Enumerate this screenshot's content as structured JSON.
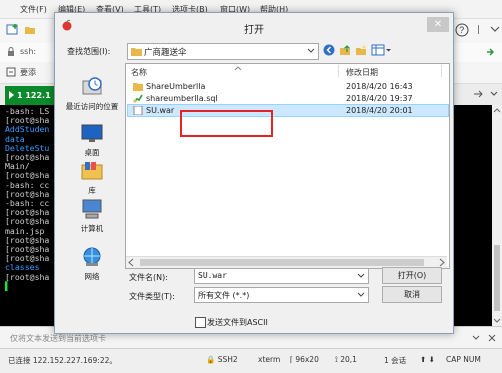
{
  "background_app": {
    "menu": [
      "文件(F)",
      "编辑(E)",
      "查看(V)",
      "工具(T)",
      "选项卡(B)",
      "窗口(W)",
      "帮助(H)"
    ],
    "address_text": "ssh:",
    "quick_label": "要添",
    "tab_label": "1 122.1",
    "terminal_lines": [
      {
        "text": "-bash: LS",
        "color": "#cfcfcf"
      },
      {
        "text": "[root@sha",
        "color": "#cfcfcf"
      },
      {
        "text": "AddStuden",
        "color": "#3a9cff"
      },
      {
        "text": "data",
        "color": "#3a9cff"
      },
      {
        "text": "DeleteStu",
        "color": "#3a9cff"
      },
      {
        "text": "[root@sha",
        "color": "#cfcfcf"
      },
      {
        "text": "Main/",
        "color": "#cfcfcf"
      },
      {
        "text": "[root@sha",
        "color": "#cfcfcf"
      },
      {
        "text": "-bash: cc",
        "color": "#cfcfcf"
      },
      {
        "text": "[root@sha",
        "color": "#cfcfcf"
      },
      {
        "text": "-bash: cc",
        "color": "#cfcfcf"
      },
      {
        "text": "[root@sha",
        "color": "#cfcfcf"
      },
      {
        "text": "[root@sha",
        "color": "#cfcfcf"
      },
      {
        "text": "main.jsp",
        "color": "#cfcfcf"
      },
      {
        "text": "[root@sha",
        "color": "#cfcfcf"
      },
      {
        "text": "[root@sha",
        "color": "#cfcfcf"
      },
      {
        "text": "[root@sha",
        "color": "#cfcfcf"
      },
      {
        "text": "classes",
        "color": "#3a9cff"
      },
      {
        "text": "[root@sha",
        "color": "#cfcfcf"
      },
      {
        "text": "▌",
        "color": "#19e04a"
      }
    ],
    "send_bar_placeholder": "仅将文本发送到当前选项卡",
    "status": {
      "connection": "已连接 122.152.227.169:22。",
      "protocol": "SSH2",
      "term": "xterm",
      "size": "96x20",
      "cursor": "20,1",
      "sessions": "1 会话",
      "keys": "CAP  NUM"
    }
  },
  "dialog": {
    "title": "打开",
    "look_in_label": "查找范围(I):",
    "look_in_value": "广商趣送伞",
    "columns": {
      "name": "名称",
      "date": "修改日期"
    },
    "files": [
      {
        "name": "ShareUmberlla",
        "date": "2018/4/20 16:43",
        "type": "folder",
        "selected": false
      },
      {
        "name": "shareumberlla.sql",
        "date": "2018/4/20 19:37",
        "type": "sql",
        "selected": false
      },
      {
        "name": "SU.war",
        "date": "2018/4/20 20:01",
        "type": "war",
        "selected": true
      }
    ],
    "sidebar": [
      {
        "label": "最近访问的位置",
        "icon": "recent-places-icon"
      },
      {
        "label": "桌面",
        "icon": "desktop-icon"
      },
      {
        "label": "库",
        "icon": "libraries-icon"
      },
      {
        "label": "计算机",
        "icon": "computer-icon"
      },
      {
        "label": "网络",
        "icon": "network-icon"
      }
    ],
    "filename_label": "文件名(N):",
    "filename_value": "SU.war",
    "filetype_label": "文件类型(T):",
    "filetype_value": "所有文件 (*.*)",
    "open_button": "打开(O)",
    "cancel_button": "取消",
    "ascii_checkbox_label": "发送文件到ASCII",
    "ascii_checked": false,
    "highlight_color": "#e82323"
  }
}
